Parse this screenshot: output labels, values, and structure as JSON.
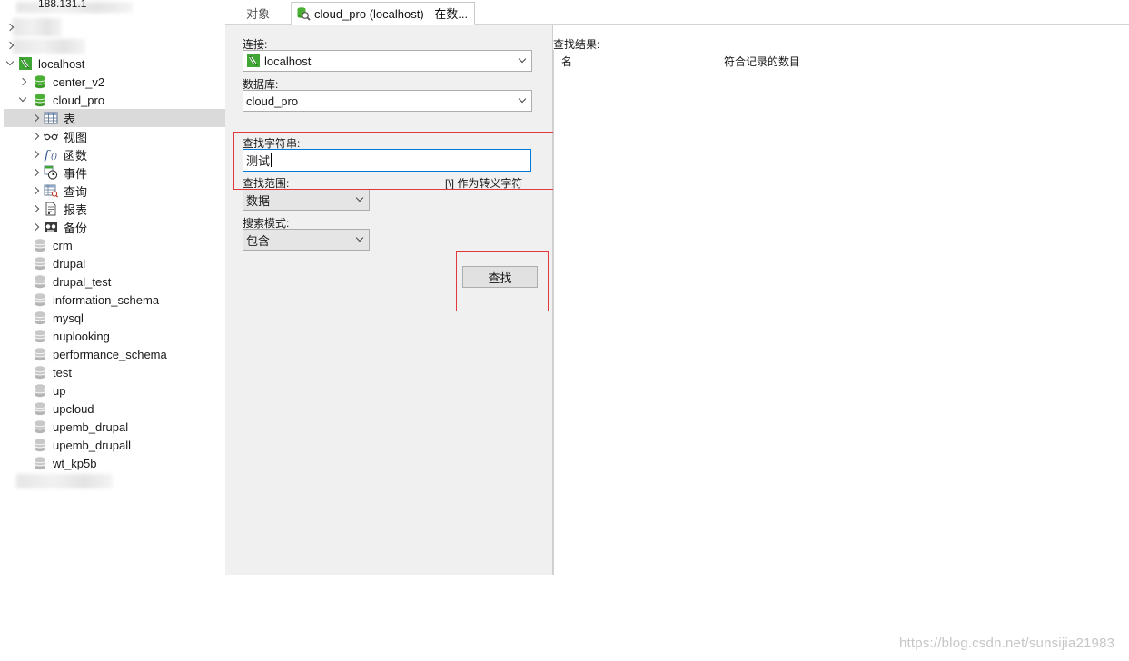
{
  "tree": {
    "top_partial": "188.131.1",
    "connection": "localhost",
    "databases_before": [
      "center_v2"
    ],
    "open_db": "cloud_pro",
    "children": [
      "表",
      "视图",
      "函数",
      "事件",
      "查询",
      "报表",
      "备份"
    ],
    "databases_after": [
      "crm",
      "drupal",
      "drupal_test",
      "information_schema",
      "mysql",
      "nuplooking",
      "performance_schema",
      "test",
      "up",
      "upcloud",
      "upemb_drupal",
      "upemb_drupall",
      "wt_kp5b"
    ]
  },
  "tabs": {
    "objects": "对象",
    "active": "cloud_pro (localhost) - 在数..."
  },
  "form": {
    "connection_label": "连接:",
    "connection_value": "localhost",
    "database_label": "数据库:",
    "database_value": "cloud_pro",
    "search_string_label": "查找字符串:",
    "search_string_value": "测试",
    "escape_note": "[\\] 作为转义字符",
    "scope_label": "查找范围:",
    "scope_value": "数据",
    "mode_label": "搜索模式:",
    "mode_value": "包含",
    "find_button": "查找"
  },
  "results": {
    "label": "查找结果:",
    "col_name": "名",
    "col_count": "符合记录的数目"
  },
  "colors": {
    "highlight_box": "#e0393e",
    "focus_border": "#0078d7",
    "navicat_green": "#3fa535",
    "db_green": "#4caf35"
  },
  "watermark": "https://blog.csdn.net/sunsijia21983"
}
